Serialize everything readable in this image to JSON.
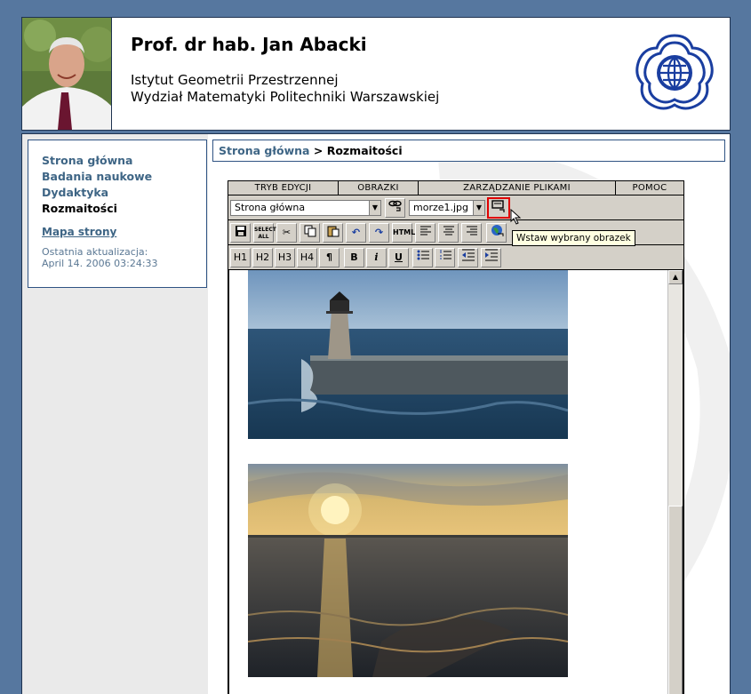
{
  "header": {
    "name": "Prof. dr hab. Jan Abacki",
    "institute_line1": "Istytut Geometrii Przestrzennej",
    "institute_line2": "Wydział Matematyki Politechniki Warszawskiej"
  },
  "sidebar": {
    "items": [
      {
        "label": "Strona główna"
      },
      {
        "label": "Badania naukowe"
      },
      {
        "label": "Dydaktyka"
      },
      {
        "label": "Rozmaitości"
      }
    ],
    "sitemap_label": "Mapa strony",
    "update_label": "Ostatnia aktualizacja:",
    "update_value": "April 14. 2006 03:24:33"
  },
  "breadcrumb": {
    "home": "Strona główna",
    "separator": ">",
    "current": "Rozmaitości"
  },
  "editor": {
    "menu": [
      "TRYB EDYCJI",
      "OBRAZKI",
      "ZARZĄDZANIE PLIKAMI",
      "POMOC"
    ],
    "page_select_value": "Strona główna",
    "image_select_value": "morze1.jpg",
    "tooltip": "Wstaw wybrany obrazek",
    "buttons": {
      "select_all": "SELECT ALL",
      "html": "HTML",
      "h1": "H1",
      "h2": "H2",
      "h3": "H3",
      "h4": "H4",
      "para": "¶",
      "bold": "B",
      "italic": "i",
      "underline": "U"
    }
  },
  "colors": {
    "page_bg": "#56779f",
    "link": "#3e6585",
    "border": "#2f5383"
  }
}
